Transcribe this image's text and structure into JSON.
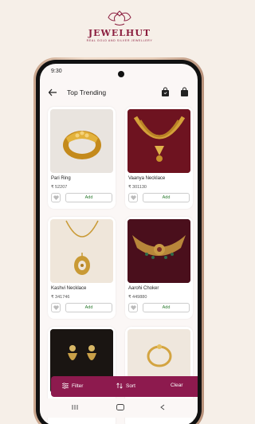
{
  "brand": {
    "name": "JEWELHUT",
    "tagline": "REAL GOLD AND SILVER JEWELLERY"
  },
  "status_bar": {
    "time": "9:30"
  },
  "app_bar": {
    "title": "Top Trending"
  },
  "products": [
    {
      "name": "Pari Ring",
      "price": "₹ 52207",
      "add_label": "Add"
    },
    {
      "name": "Vaanya Necklace",
      "price": "₹ 301130",
      "add_label": "Add"
    },
    {
      "name": "Kashvi Necklace",
      "price": "₹ 341746",
      "add_label": "Add"
    },
    {
      "name": "Aarohi Choker",
      "price": "₹ 449880",
      "add_label": "Add"
    },
    {
      "name": "",
      "price": "",
      "add_label": ""
    },
    {
      "name": "",
      "price": "",
      "add_label": ""
    }
  ],
  "bottom_actions": {
    "filter": "Filter",
    "sort": "Sort",
    "clear": "Clear"
  },
  "colors": {
    "brand": "#8b1e3f",
    "action_bar": "#8d1a4e",
    "add_text": "#2e7d32",
    "background": "#f6efe8"
  },
  "icons": [
    "back-arrow-icon",
    "shopping-bag-icon",
    "cart-bag-icon",
    "heart-icon",
    "filter-icon",
    "sort-icon",
    "recents-icon",
    "home-icon",
    "nav-back-icon"
  ]
}
